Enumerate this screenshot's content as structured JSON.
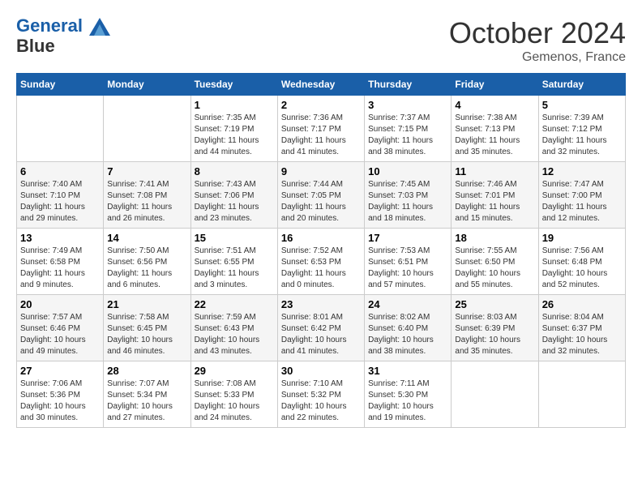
{
  "header": {
    "logo_line1": "General",
    "logo_line2": "Blue",
    "month": "October 2024",
    "location": "Gemenos, France"
  },
  "weekdays": [
    "Sunday",
    "Monday",
    "Tuesday",
    "Wednesday",
    "Thursday",
    "Friday",
    "Saturday"
  ],
  "weeks": [
    [
      {
        "day": "",
        "info": ""
      },
      {
        "day": "",
        "info": ""
      },
      {
        "day": "1",
        "info": "Sunrise: 7:35 AM\nSunset: 7:19 PM\nDaylight: 11 hours and 44 minutes."
      },
      {
        "day": "2",
        "info": "Sunrise: 7:36 AM\nSunset: 7:17 PM\nDaylight: 11 hours and 41 minutes."
      },
      {
        "day": "3",
        "info": "Sunrise: 7:37 AM\nSunset: 7:15 PM\nDaylight: 11 hours and 38 minutes."
      },
      {
        "day": "4",
        "info": "Sunrise: 7:38 AM\nSunset: 7:13 PM\nDaylight: 11 hours and 35 minutes."
      },
      {
        "day": "5",
        "info": "Sunrise: 7:39 AM\nSunset: 7:12 PM\nDaylight: 11 hours and 32 minutes."
      }
    ],
    [
      {
        "day": "6",
        "info": "Sunrise: 7:40 AM\nSunset: 7:10 PM\nDaylight: 11 hours and 29 minutes."
      },
      {
        "day": "7",
        "info": "Sunrise: 7:41 AM\nSunset: 7:08 PM\nDaylight: 11 hours and 26 minutes."
      },
      {
        "day": "8",
        "info": "Sunrise: 7:43 AM\nSunset: 7:06 PM\nDaylight: 11 hours and 23 minutes."
      },
      {
        "day": "9",
        "info": "Sunrise: 7:44 AM\nSunset: 7:05 PM\nDaylight: 11 hours and 20 minutes."
      },
      {
        "day": "10",
        "info": "Sunrise: 7:45 AM\nSunset: 7:03 PM\nDaylight: 11 hours and 18 minutes."
      },
      {
        "day": "11",
        "info": "Sunrise: 7:46 AM\nSunset: 7:01 PM\nDaylight: 11 hours and 15 minutes."
      },
      {
        "day": "12",
        "info": "Sunrise: 7:47 AM\nSunset: 7:00 PM\nDaylight: 11 hours and 12 minutes."
      }
    ],
    [
      {
        "day": "13",
        "info": "Sunrise: 7:49 AM\nSunset: 6:58 PM\nDaylight: 11 hours and 9 minutes."
      },
      {
        "day": "14",
        "info": "Sunrise: 7:50 AM\nSunset: 6:56 PM\nDaylight: 11 hours and 6 minutes."
      },
      {
        "day": "15",
        "info": "Sunrise: 7:51 AM\nSunset: 6:55 PM\nDaylight: 11 hours and 3 minutes."
      },
      {
        "day": "16",
        "info": "Sunrise: 7:52 AM\nSunset: 6:53 PM\nDaylight: 11 hours and 0 minutes."
      },
      {
        "day": "17",
        "info": "Sunrise: 7:53 AM\nSunset: 6:51 PM\nDaylight: 10 hours and 57 minutes."
      },
      {
        "day": "18",
        "info": "Sunrise: 7:55 AM\nSunset: 6:50 PM\nDaylight: 10 hours and 55 minutes."
      },
      {
        "day": "19",
        "info": "Sunrise: 7:56 AM\nSunset: 6:48 PM\nDaylight: 10 hours and 52 minutes."
      }
    ],
    [
      {
        "day": "20",
        "info": "Sunrise: 7:57 AM\nSunset: 6:46 PM\nDaylight: 10 hours and 49 minutes."
      },
      {
        "day": "21",
        "info": "Sunrise: 7:58 AM\nSunset: 6:45 PM\nDaylight: 10 hours and 46 minutes."
      },
      {
        "day": "22",
        "info": "Sunrise: 7:59 AM\nSunset: 6:43 PM\nDaylight: 10 hours and 43 minutes."
      },
      {
        "day": "23",
        "info": "Sunrise: 8:01 AM\nSunset: 6:42 PM\nDaylight: 10 hours and 41 minutes."
      },
      {
        "day": "24",
        "info": "Sunrise: 8:02 AM\nSunset: 6:40 PM\nDaylight: 10 hours and 38 minutes."
      },
      {
        "day": "25",
        "info": "Sunrise: 8:03 AM\nSunset: 6:39 PM\nDaylight: 10 hours and 35 minutes."
      },
      {
        "day": "26",
        "info": "Sunrise: 8:04 AM\nSunset: 6:37 PM\nDaylight: 10 hours and 32 minutes."
      }
    ],
    [
      {
        "day": "27",
        "info": "Sunrise: 7:06 AM\nSunset: 5:36 PM\nDaylight: 10 hours and 30 minutes."
      },
      {
        "day": "28",
        "info": "Sunrise: 7:07 AM\nSunset: 5:34 PM\nDaylight: 10 hours and 27 minutes."
      },
      {
        "day": "29",
        "info": "Sunrise: 7:08 AM\nSunset: 5:33 PM\nDaylight: 10 hours and 24 minutes."
      },
      {
        "day": "30",
        "info": "Sunrise: 7:10 AM\nSunset: 5:32 PM\nDaylight: 10 hours and 22 minutes."
      },
      {
        "day": "31",
        "info": "Sunrise: 7:11 AM\nSunset: 5:30 PM\nDaylight: 10 hours and 19 minutes."
      },
      {
        "day": "",
        "info": ""
      },
      {
        "day": "",
        "info": ""
      }
    ]
  ]
}
